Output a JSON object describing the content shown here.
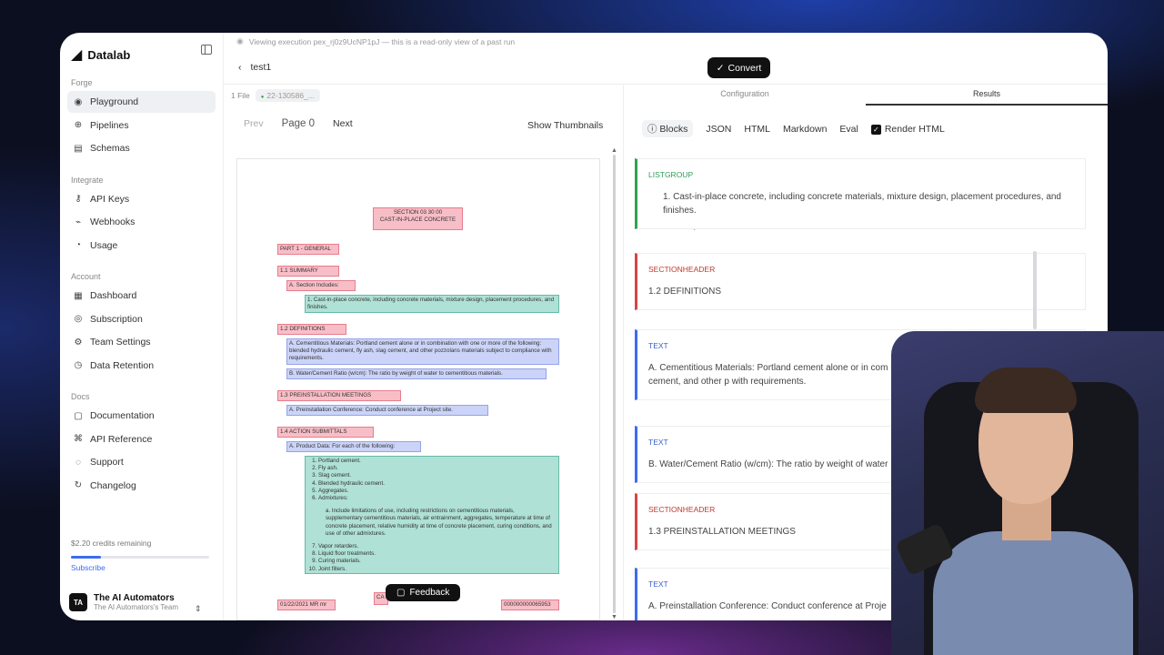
{
  "sidebar": {
    "brand": "Datalab",
    "sections": [
      {
        "label": "Forge",
        "items": [
          {
            "label": "Playground",
            "icon": "playground-icon",
            "glyph": "◉",
            "active": true
          },
          {
            "label": "Pipelines",
            "icon": "pipelines-icon",
            "glyph": "⊕"
          },
          {
            "label": "Schemas",
            "icon": "schemas-icon",
            "glyph": "▤"
          }
        ]
      },
      {
        "label": "Integrate",
        "items": [
          {
            "label": "API Keys",
            "icon": "key-icon",
            "glyph": "⚷"
          },
          {
            "label": "Webhooks",
            "icon": "webhook-icon",
            "glyph": "⌁"
          },
          {
            "label": "Usage",
            "icon": "usage-icon",
            "glyph": "◔"
          }
        ]
      },
      {
        "label": "Account",
        "items": [
          {
            "label": "Dashboard",
            "icon": "dashboard-icon",
            "glyph": "▦"
          },
          {
            "label": "Subscription",
            "icon": "subscription-icon",
            "glyph": "◎"
          },
          {
            "label": "Team Settings",
            "icon": "team-settings-icon",
            "glyph": "⚙"
          },
          {
            "label": "Data Retention",
            "icon": "data-retention-icon",
            "glyph": "◷"
          }
        ]
      },
      {
        "label": "Docs",
        "items": [
          {
            "label": "Documentation",
            "icon": "documentation-icon",
            "glyph": "▢"
          },
          {
            "label": "API Reference",
            "icon": "api-reference-icon",
            "glyph": "⌘"
          },
          {
            "label": "Support",
            "icon": "support-icon",
            "glyph": "◌"
          },
          {
            "label": "Changelog",
            "icon": "changelog-icon",
            "glyph": "↻"
          }
        ]
      }
    ],
    "credits": "$2.20 credits remaining",
    "credits_fraction": 0.22,
    "subscribe": "Subscribe",
    "team_initials": "TA",
    "team_name": "The AI Automators",
    "team_sub": "The AI Automators's Team"
  },
  "header": {
    "banner": "Viewing execution pex_rj0z9UcNP1pJ — this is a read-only view of a past run",
    "back": "‹",
    "title": "test1",
    "convert": "Convert",
    "file_count": "1 File",
    "file_chip": "22-130586_..."
  },
  "right_tabs": {
    "configuration": "Configuration",
    "results": "Results"
  },
  "pager": {
    "prev": "Prev",
    "page": "Page 0",
    "next": "Next",
    "thumbnails": "Show Thumbnails"
  },
  "format_tabs": {
    "blocks": "Blocks",
    "json": "JSON",
    "html": "HTML",
    "markdown": "Markdown",
    "eval": "Eval",
    "render_html": "Render HTML"
  },
  "doc": {
    "section_title": "SECTION 03 30 00",
    "section_sub": "CAST-IN-PLACE CONCRETE",
    "part1": "PART 1 - GENERAL",
    "h11": "1.1      SUMMARY",
    "sec_includes": "A.     Section Includes:",
    "item1": "1.     Cast-in-place concrete, including concrete materials, mixture design, placement procedures, and finishes.",
    "h12": "1.2      DEFINITIONS",
    "defA": "A.     Cementitious Materials: Portland cement alone or in combination with one or more of the following: blended hydraulic cement, fly ash, slag cement, and other pozzolans materials subject to compliance with requirements.",
    "defB": "B.     Water/Cement Ratio (w/cm): The ratio by weight of water to cementitious materials.",
    "h13": "1.3      PREINSTALLATION MEETINGS",
    "preA": "A.     Preinstallation Conference: Conduct conference at Project site.",
    "h14": "1.4      ACTION SUBMITTALS",
    "prodA": "A.     Product Data: For each of the following:",
    "list": [
      "Portland cement.",
      "Fly ash.",
      "Slag cement.",
      "Blended hydraulic cement.",
      "Aggregates.",
      "Admixtures:"
    ],
    "sublist": "a.     Include limitations of use, including restrictions on cementitious materials, supplementary cementitious materials, air entrainment, aggregates, temperature at time of concrete placement, relative humidity at time of concrete placement, curing conditions, and use of other admixtures.",
    "list2": [
      "Vapor retarders.",
      "Liquid floor treatments.",
      "Curing materials.",
      "Joint fillers."
    ],
    "footer_left": "01/22/2021 MR mr",
    "footer_mid": "CA",
    "footer_right": "000000000065953"
  },
  "feedback": "Feedback",
  "results": [
    {
      "type": "LISTGROUP",
      "color": "green",
      "text": "1. Cast-in-place concrete, including concrete materials, mixture design, placement procedures, and finishes."
    },
    {
      "type": "SECTIONHEADER",
      "color": "red",
      "text": "1.2 DEFINITIONS"
    },
    {
      "type": "TEXT",
      "color": "blue",
      "text": "A. Cementitious Materials: Portland cement alone or in com blended hydraulic cement, fly ash, slag cement, and other p with requirements."
    },
    {
      "type": "TEXT",
      "color": "blue",
      "text": "B. Water/Cement Ratio (w/cm): The ratio by weight of water"
    },
    {
      "type": "SECTIONHEADER",
      "color": "red",
      "text": "1.3 PREINSTALLATION MEETINGS"
    },
    {
      "type": "TEXT",
      "color": "blue",
      "text": "A. Preinstallation Conference: Conduct conference at Proje"
    }
  ]
}
